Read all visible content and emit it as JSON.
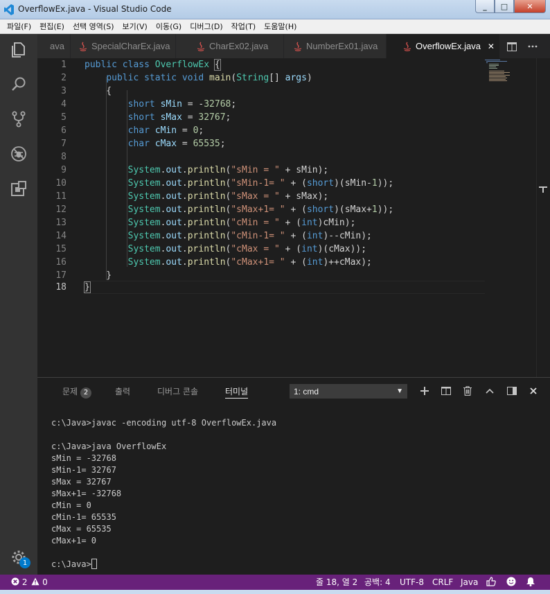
{
  "window": {
    "title": "OverflowEx.java - Visual Studio Code",
    "minimize": "_",
    "maximize": "□",
    "close": "✕"
  },
  "menu": [
    "파일(F)",
    "편집(E)",
    "선택 영역(S)",
    "보기(V)",
    "이동(G)",
    "디버그(D)",
    "작업(T)",
    "도움말(H)"
  ],
  "tabs": [
    {
      "label": "ava",
      "active": false
    },
    {
      "label": "SpecialCharEx.java",
      "active": false
    },
    {
      "label": "CharEx02.java",
      "active": false
    },
    {
      "label": "NumberEx01.java",
      "active": false
    },
    {
      "label": "OverflowEx.java",
      "active": true
    }
  ],
  "tab_close": "✕",
  "editor": {
    "line_numbers": [
      "1",
      "2",
      "3",
      "4",
      "5",
      "6",
      "7",
      "8",
      "9",
      "10",
      "11",
      "12",
      "13",
      "14",
      "15",
      "16",
      "17",
      "18"
    ],
    "current_line": "18"
  },
  "panel": {
    "tabs": [
      "문제",
      "출력",
      "디버그 콘솔",
      "터미널"
    ],
    "problems_count": "2",
    "terminal_select": "1: cmd",
    "terminal_lines": [
      "c:\\Java>javac -encoding utf-8 OverflowEx.java",
      "",
      "c:\\Java>java OverflowEx",
      "sMin = -32768",
      "sMin-1= 32767",
      "sMax = 32767",
      "sMax+1= -32768",
      "cMin = 0",
      "cMin-1= 65535",
      "cMax = 65535",
      "cMax+1= 0",
      "",
      "c:\\Java>"
    ]
  },
  "status": {
    "errors": "2",
    "warnings": "0",
    "position": "줄 18, 열 2",
    "spaces": "공백: 4",
    "encoding": "UTF-8",
    "eol": "CRLF",
    "language": "Java"
  },
  "activity_badge": "1",
  "colors": {
    "status_bar": "#68217a",
    "accent": "#007acc",
    "editor_bg": "#1e1e1e"
  }
}
